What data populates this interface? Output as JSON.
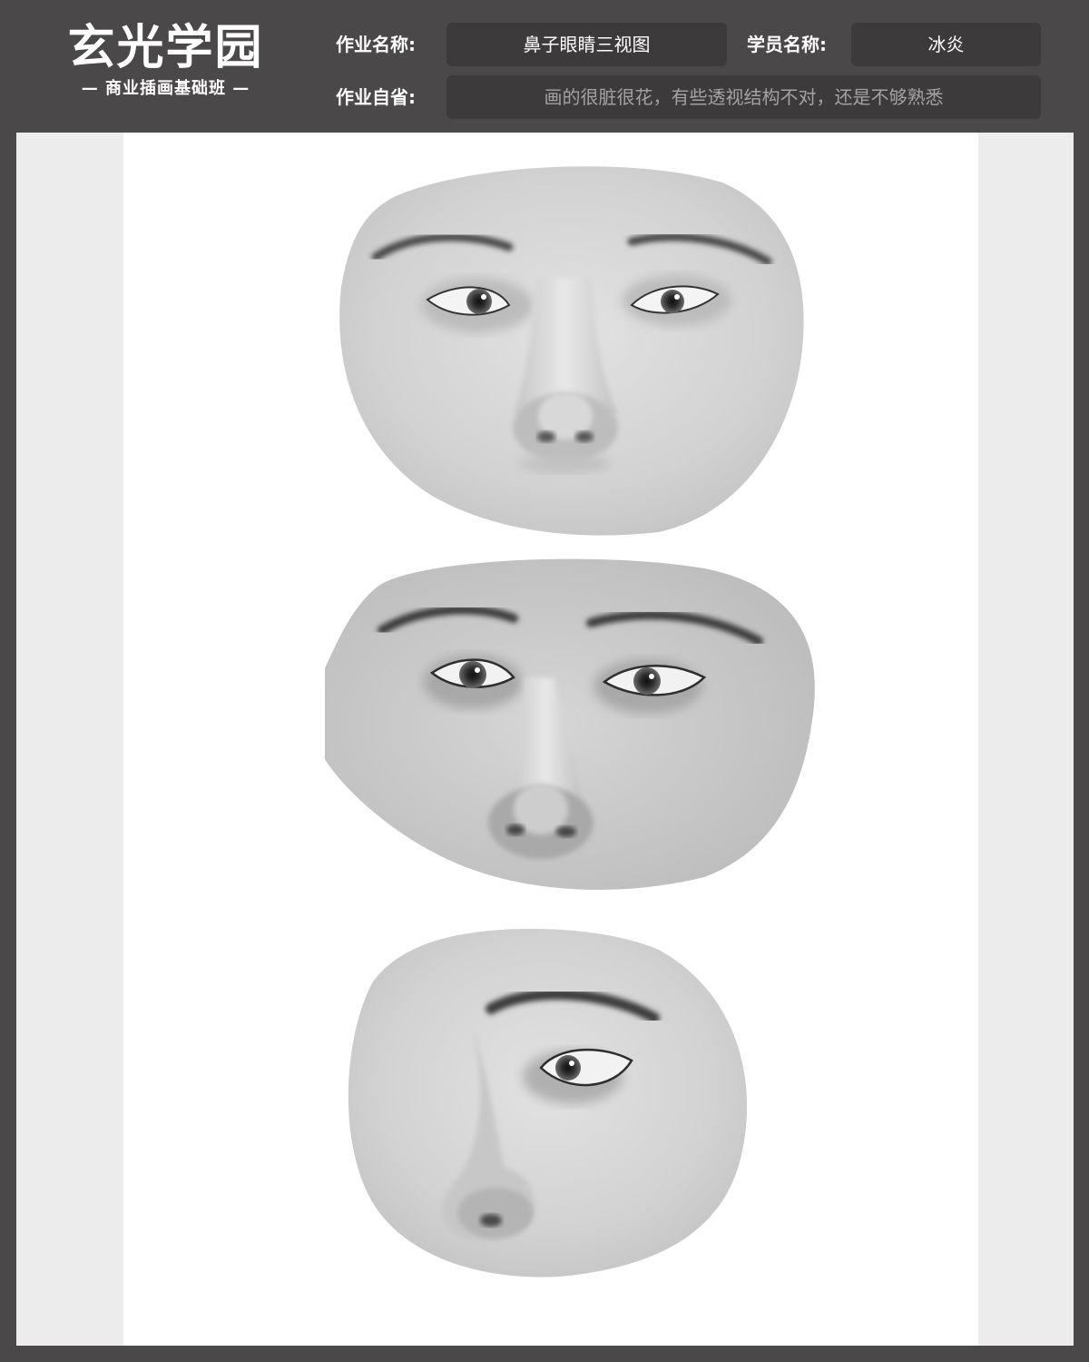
{
  "logo": {
    "title": "玄光学园",
    "subtitle": "— 商业插画基础班 —"
  },
  "fields": {
    "homework_name_label": "作业名称:",
    "homework_name_value": "鼻子眼睛三视图",
    "student_name_label": "学员名称:",
    "student_name_value": "冰炎",
    "self_review_label": "作业自省:",
    "self_review_value": "画的很脏很花，有些透视结构不对，还是不够熟悉"
  },
  "artwork": {
    "views": [
      "front-view",
      "three-quarter-view",
      "side-view"
    ]
  }
}
